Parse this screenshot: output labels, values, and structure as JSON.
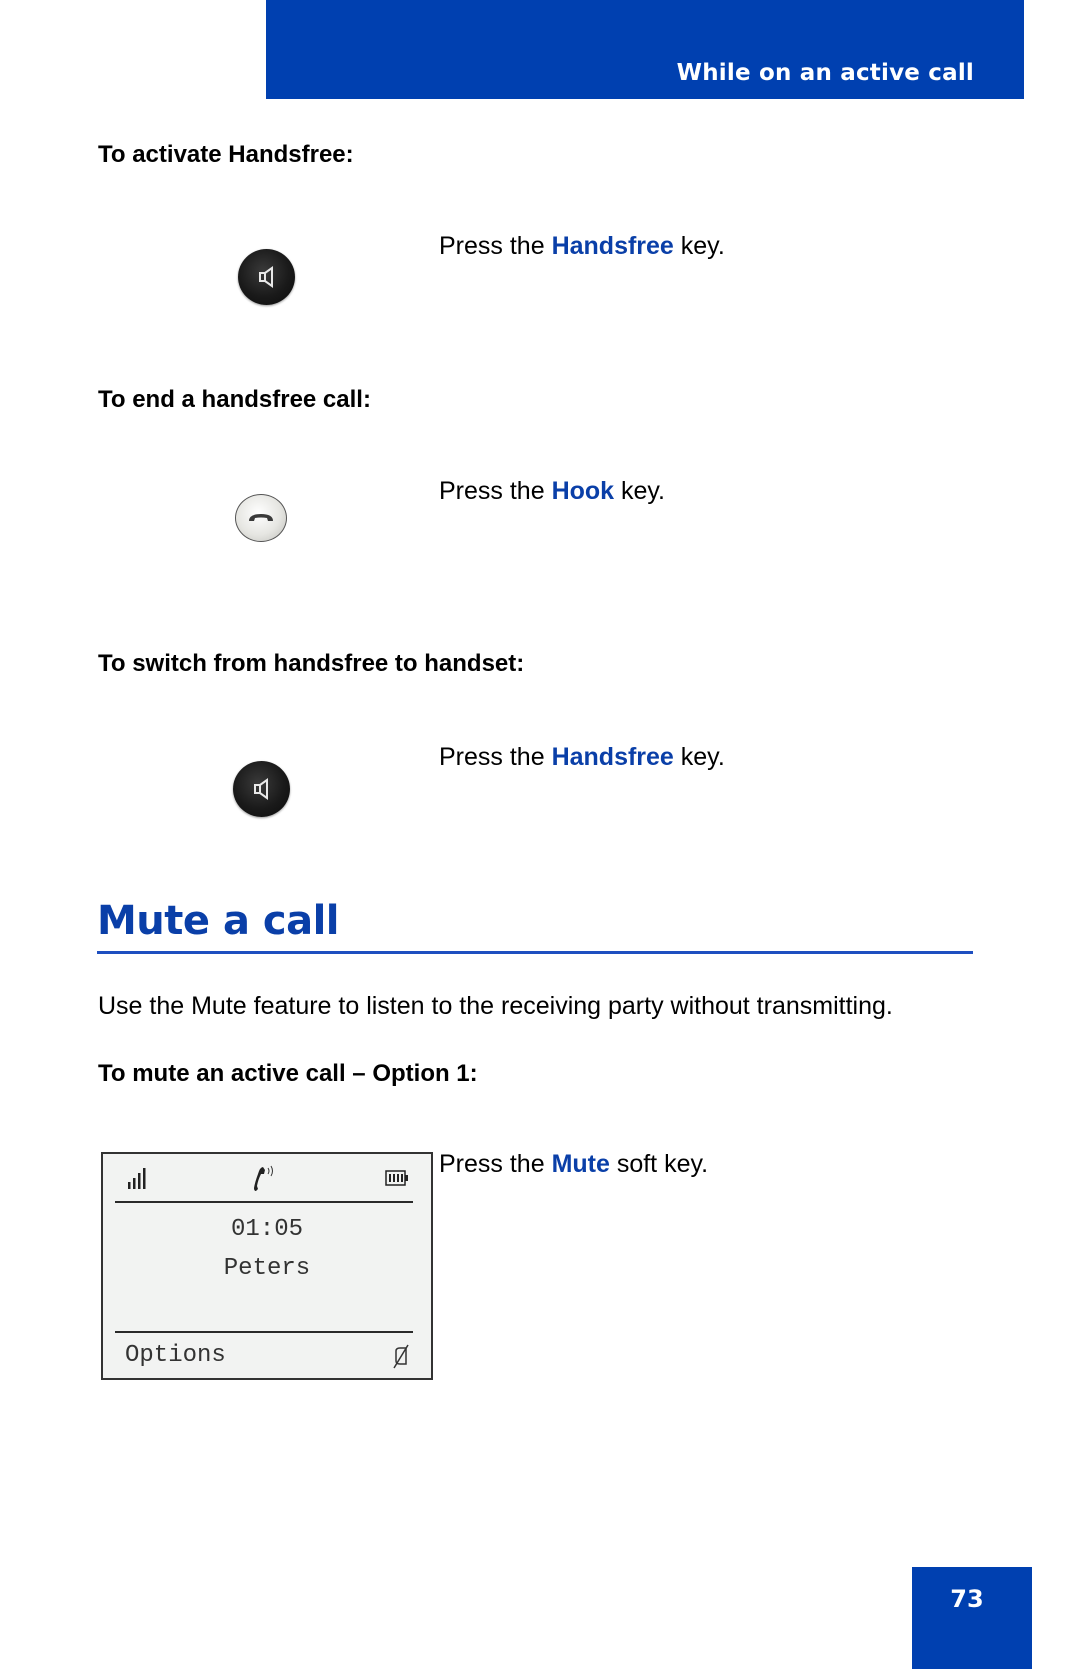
{
  "header": {
    "title": "While on an active call"
  },
  "steps": [
    {
      "heading": "To activate Handsfree:",
      "instruction": {
        "prefix": "Press the ",
        "keyword": "Handsfree",
        "suffix": " key."
      },
      "key_icon": "speaker-icon"
    },
    {
      "heading": "To end a handsfree call:",
      "instruction": {
        "prefix": "Press the ",
        "keyword": "Hook",
        "suffix": " key."
      },
      "key_icon": "hook-handset-icon"
    },
    {
      "heading": "To switch from handsfree to handset:",
      "instruction": {
        "prefix": "Press the ",
        "keyword": "Handsfree",
        "suffix": " key."
      },
      "key_icon": "speaker-icon"
    }
  ],
  "section": {
    "title": "Mute a call",
    "description": "Use the Mute feature to listen to the receiving party without transmitting.",
    "option_heading": "To mute an active call – Option 1:",
    "instruction": {
      "prefix": "Press the ",
      "keyword": "Mute",
      "suffix": " soft key."
    }
  },
  "phone_display": {
    "status_icons": [
      "signal-strength-icon",
      "active-call-icon",
      "battery-icon"
    ],
    "call_timer": "01:05",
    "caller_name": "Peters",
    "softkey_left": "Options",
    "softkey_right_icon": "mute-icon"
  },
  "page_number": "73",
  "colors": {
    "brand_blue": "#0040b0",
    "keyword_blue": "#0a3fa8"
  }
}
